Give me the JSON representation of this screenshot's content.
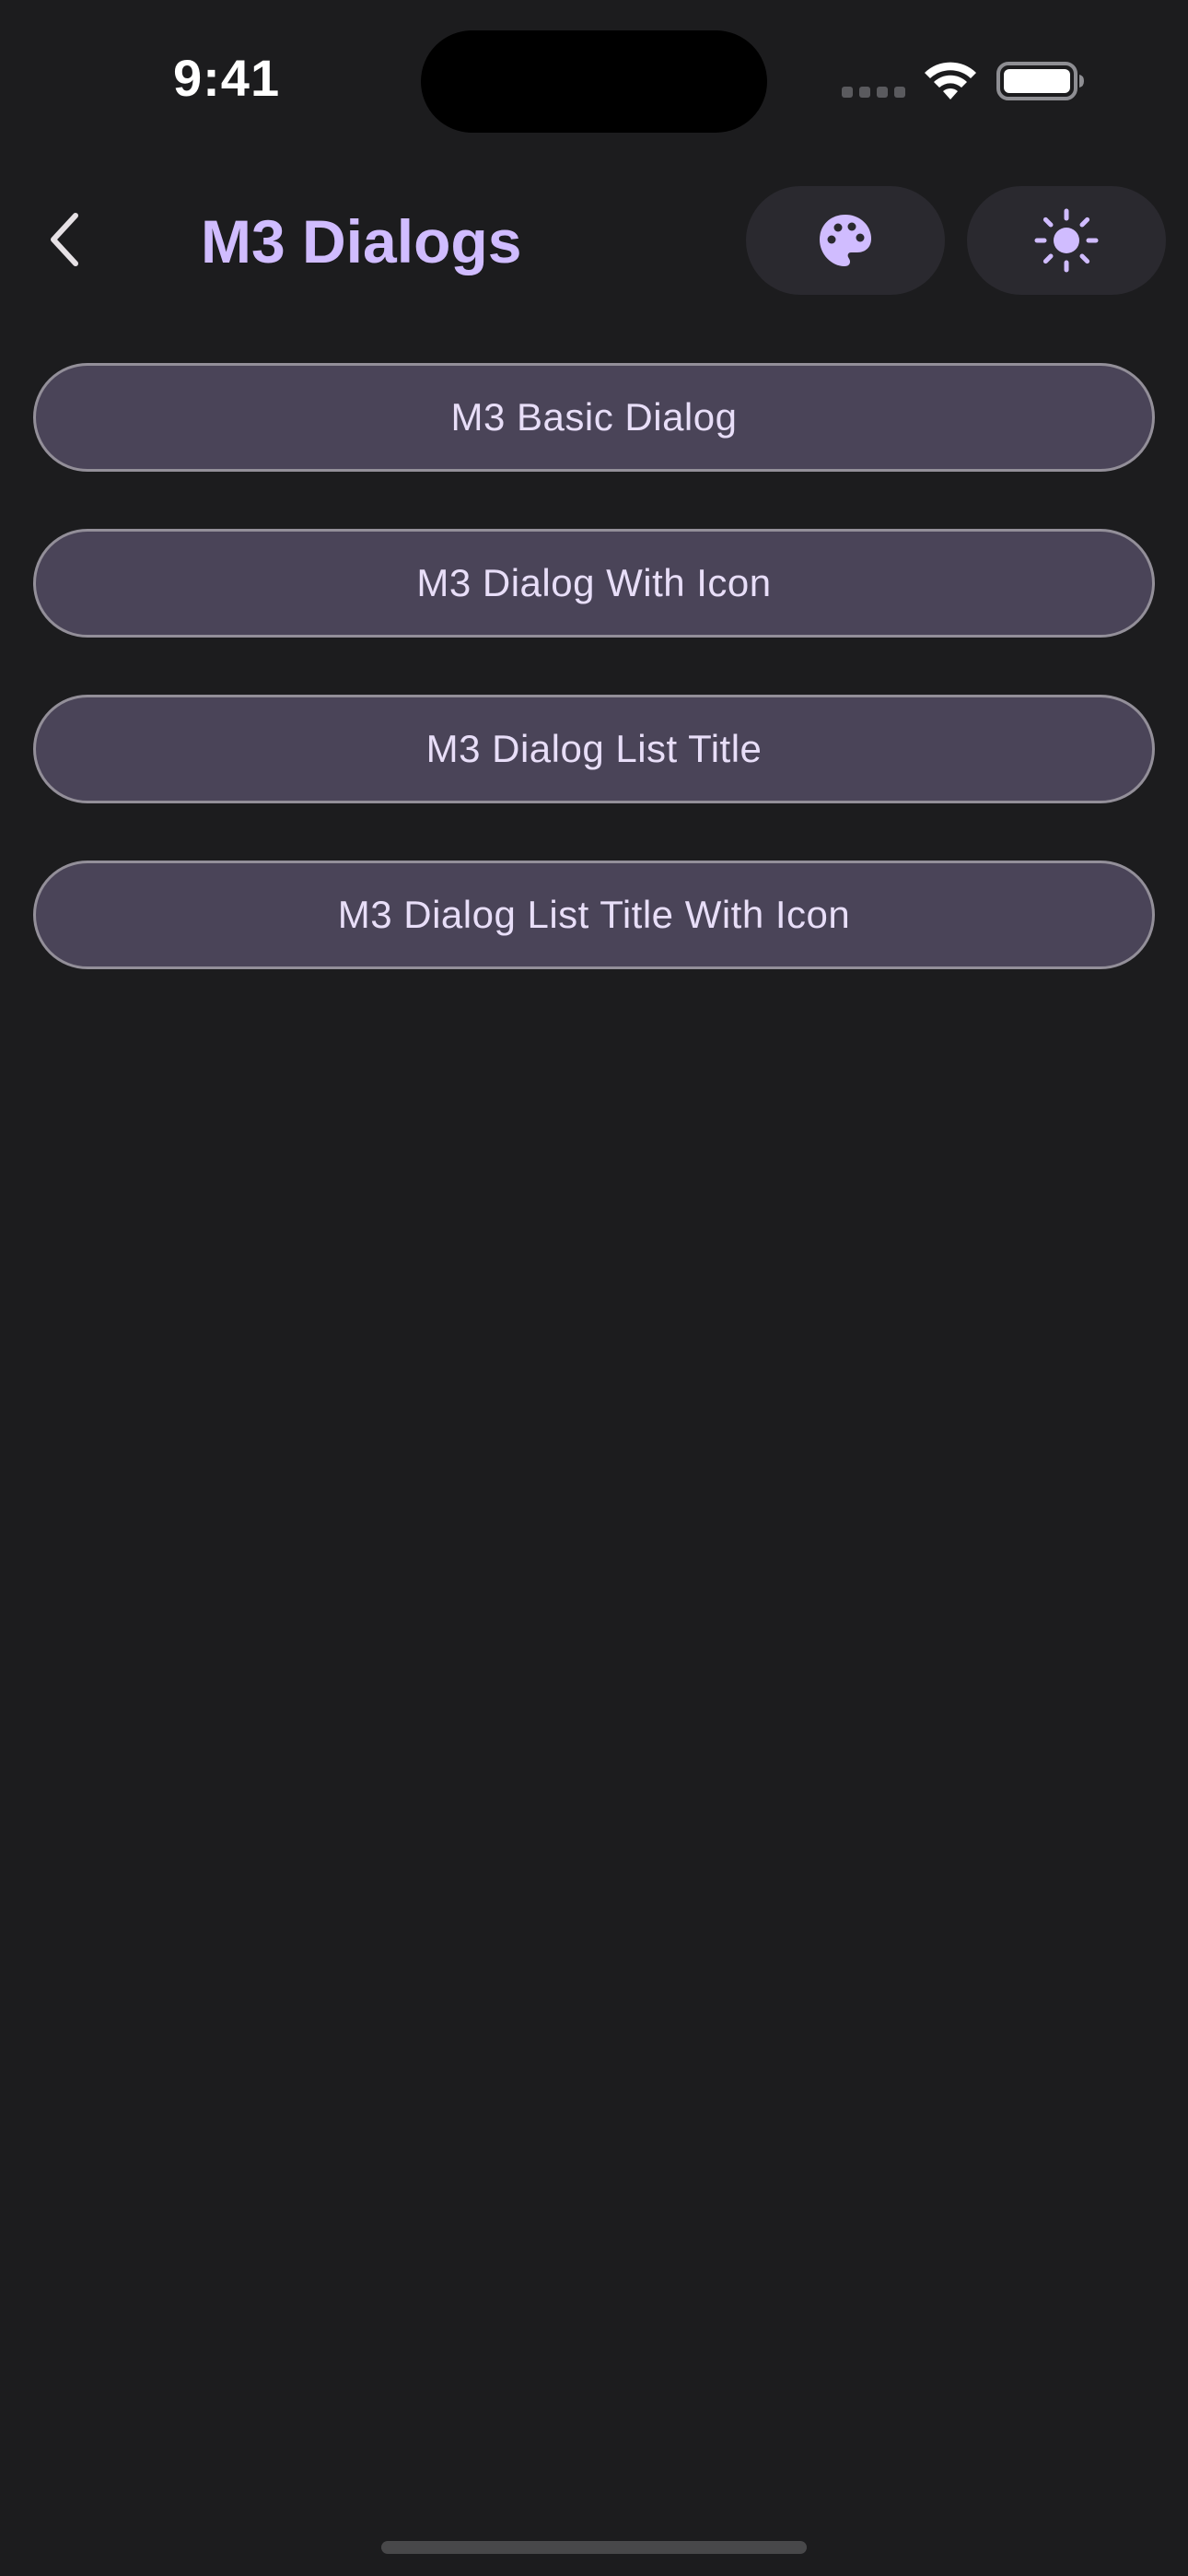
{
  "status_bar": {
    "time": "9:41"
  },
  "app_bar": {
    "title": "M3 Dialogs",
    "back_icon": "chevron-left-icon",
    "actions": [
      {
        "name": "palette",
        "icon": "palette-icon"
      },
      {
        "name": "theme",
        "icon": "sun-icon"
      }
    ]
  },
  "dialog_buttons": [
    {
      "label": "M3 Basic Dialog"
    },
    {
      "label": "M3 Dialog With Icon"
    },
    {
      "label": "M3 Dialog List Title"
    },
    {
      "label": "M3 Dialog List Title With Icon"
    }
  ],
  "colors": {
    "background": "#1c1c1e",
    "accent": "#d0bcff",
    "button_fill": "#4a4458",
    "button_border": "#938f99",
    "button_text": "#e8def8"
  }
}
